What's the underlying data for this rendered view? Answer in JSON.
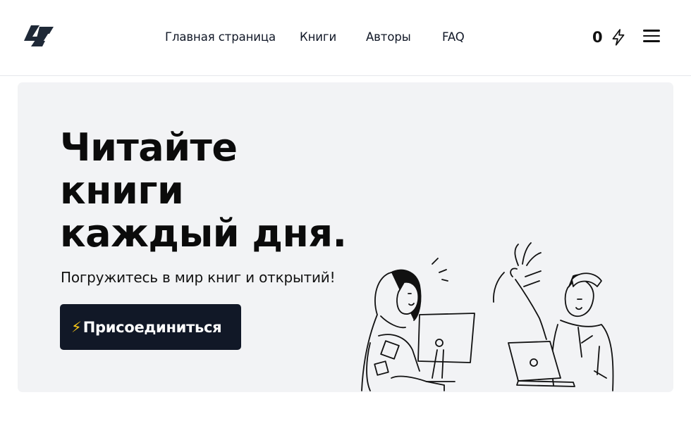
{
  "header": {
    "logo_icon": "lightning-logo-icon",
    "nav": [
      {
        "label": "Главная страница"
      },
      {
        "label": "Книги"
      },
      {
        "label": "Авторы"
      },
      {
        "label": "FAQ"
      }
    ],
    "points": "0",
    "points_icon": "bolt-icon",
    "menu_icon": "hamburger-menu-icon"
  },
  "hero": {
    "title_lines": [
      "Читайте",
      "книги",
      "каждый дня."
    ],
    "subtitle": "Погружитесь в мир книг и открытий!",
    "button": {
      "icon": "⚡",
      "label": "Присоединиться"
    },
    "illustration": "people-reading-and-waving-illustration"
  },
  "colors": {
    "hero_bg": "#f2f3f5",
    "button_bg": "#111827",
    "text": "#111111"
  }
}
